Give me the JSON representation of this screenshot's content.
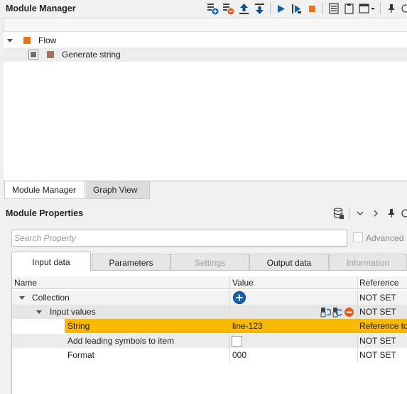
{
  "module_manager": {
    "title": "Module Manager",
    "toolbar_icons": [
      "add-module-icon",
      "remove-module-icon",
      "move-up-icon",
      "move-down-icon",
      "run-icon",
      "run-step-icon",
      "stop-icon",
      "list-view-icon",
      "clipboard-icon",
      "layout-menu-icon",
      "pin-icon",
      "restore-icon"
    ],
    "tree": [
      {
        "label": "Flow",
        "level": 0,
        "expanded": true,
        "color": "#e8731b"
      },
      {
        "label": "Generate string",
        "level": 1,
        "color": "#a9705e"
      }
    ],
    "tabs": [
      {
        "label": "Module Manager",
        "active": true
      },
      {
        "label": "Graph View",
        "active": false
      }
    ]
  },
  "module_properties": {
    "title": "Module Properties",
    "toolbar_icons": [
      "database-icon",
      "chevron-down-icon",
      "chevron-right-icon",
      "pin-icon",
      "restore-icon"
    ],
    "search": {
      "placeholder": "Search Property",
      "value": ""
    },
    "advanced_label": "Advanced",
    "tabs": [
      {
        "label": "Input data",
        "state": "active"
      },
      {
        "label": "Parameters",
        "state": "normal"
      },
      {
        "label": "Settings",
        "state": "disabled"
      },
      {
        "label": "Output data",
        "state": "normal"
      },
      {
        "label": "Information",
        "state": "disabled"
      }
    ],
    "columns": [
      "Name",
      "Value",
      "Reference"
    ],
    "rows": [
      {
        "name": "Collection",
        "value": "",
        "reference": "NOT SET"
      },
      {
        "name": "Input values",
        "value": "",
        "reference": "NOT SET"
      },
      {
        "name": "String",
        "value": "line-123",
        "reference": "Reference to"
      },
      {
        "name": "Add leading symbols to item",
        "value": "",
        "reference": "NOT SET"
      },
      {
        "name": "Format",
        "value": "000",
        "reference": "NOT SET"
      }
    ]
  },
  "colors": {
    "accent_orange": "#fbb800",
    "plus_blue": "#0b65b5",
    "flow_orange": "#e8731b"
  }
}
